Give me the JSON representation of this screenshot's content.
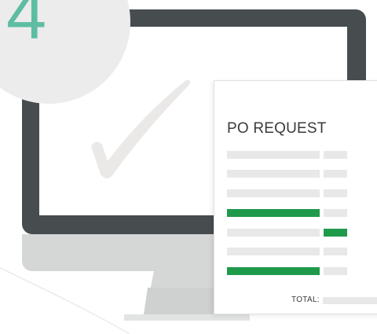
{
  "step": {
    "number": "4"
  },
  "document": {
    "title": "PO REQUEST",
    "rows": [
      {
        "bar_highlighted": false,
        "cell_highlighted": false
      },
      {
        "bar_highlighted": false,
        "cell_highlighted": false
      },
      {
        "bar_highlighted": false,
        "cell_highlighted": false
      },
      {
        "bar_highlighted": true,
        "cell_highlighted": false
      },
      {
        "bar_highlighted": false,
        "cell_highlighted": true
      },
      {
        "bar_highlighted": false,
        "cell_highlighted": false
      },
      {
        "bar_highlighted": true,
        "cell_highlighted": false
      }
    ],
    "total_label": "TOTAL:"
  },
  "colors": {
    "step_number": "#5dbda2",
    "highlight": "#1f9a4b",
    "placeholder": "#e8e8e8",
    "monitor": "#474c4f",
    "monitor_chin": "#d5d6d6",
    "checkmark": "#ebe8e8"
  },
  "icons": {
    "check": "checkmark-icon"
  }
}
